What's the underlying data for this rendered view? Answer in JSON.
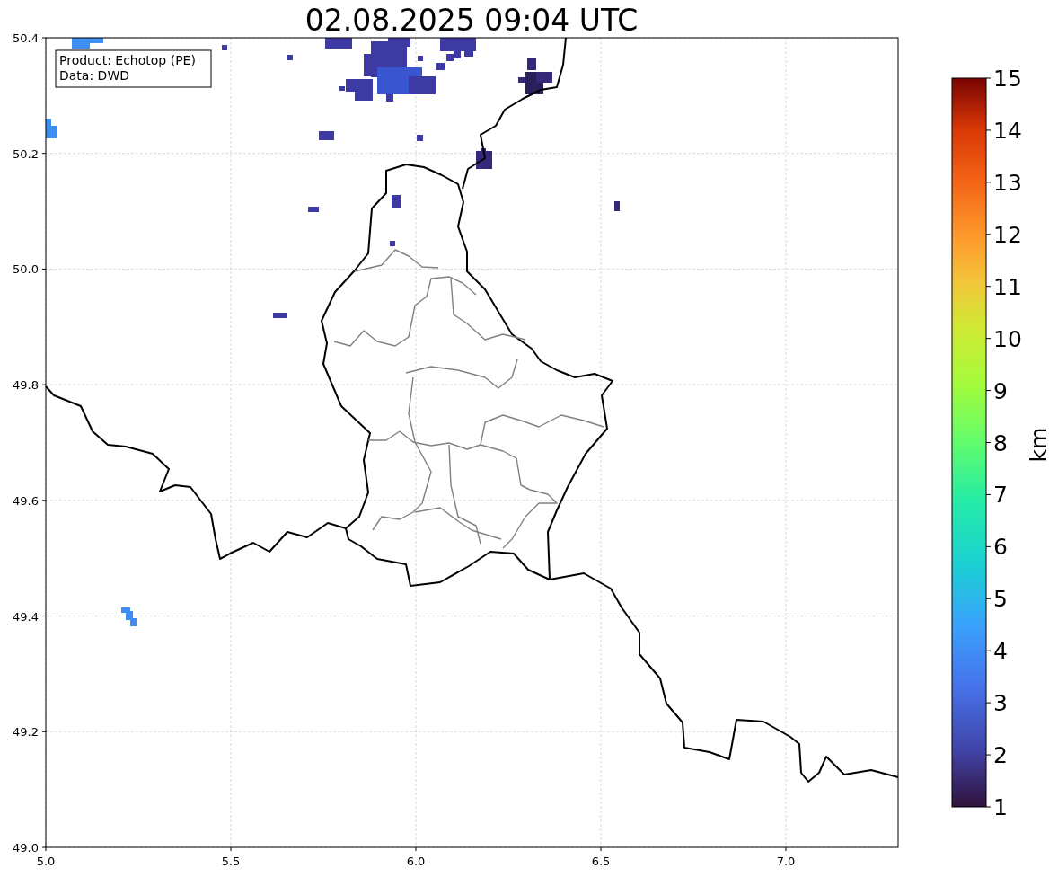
{
  "title": "02.08.2025 09:04 UTC",
  "legend": [
    "Product: Echotop (PE)",
    "Data: DWD"
  ],
  "x_axis": {
    "ticks": [
      "5.0",
      "5.5",
      "6.0",
      "6.5",
      "7.0"
    ]
  },
  "y_axis": {
    "ticks": [
      "50.4",
      "50.2",
      "50.0",
      "49.8",
      "49.6",
      "49.4",
      "49.2",
      "49.0"
    ]
  },
  "colorbar": {
    "label": "km",
    "ticks": [
      "15",
      "14",
      "13",
      "12",
      "11",
      "10",
      "9",
      "8",
      "7",
      "6",
      "5",
      "4",
      "3",
      "2",
      "1"
    ]
  }
}
